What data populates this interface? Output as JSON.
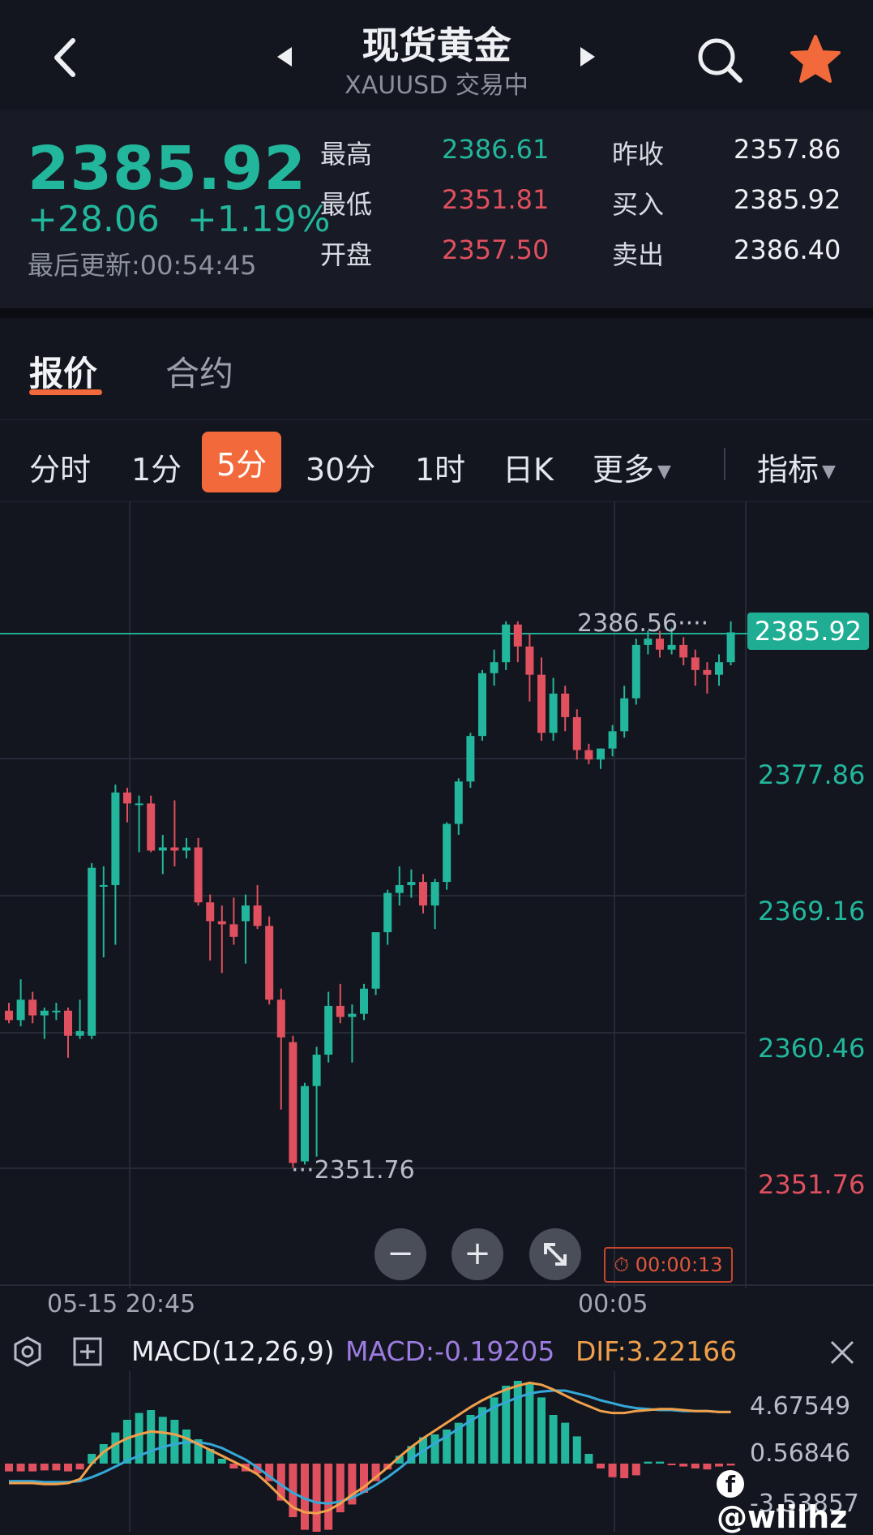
{
  "header": {
    "title": "现货黄金",
    "subtitle": "XAUUSD 交易中"
  },
  "quote": {
    "price": "2385.92",
    "change": "+28.06",
    "change_pct": "+1.19%",
    "last_update": "最后更新:00:54:45",
    "stats": [
      {
        "label": "最高",
        "value": "2386.61",
        "color": "#22b79c"
      },
      {
        "label": "最低",
        "value": "2351.81",
        "color": "#e0505e"
      },
      {
        "label": "开盘",
        "value": "2357.50",
        "color": "#e0505e"
      },
      {
        "label": "昨收",
        "value": "2357.86",
        "color": "#e9ecf2"
      },
      {
        "label": "买入",
        "value": "2385.92",
        "color": "#e9ecf2"
      },
      {
        "label": "卖出",
        "value": "2386.40",
        "color": "#e9ecf2"
      }
    ]
  },
  "tabs": [
    "报价",
    "合约"
  ],
  "periods": [
    "分时",
    "1分",
    "5分",
    "30分",
    "1时",
    "日K",
    "更多",
    "指标"
  ],
  "selected_period": "5分",
  "chart": {
    "current_tag": "2385.92",
    "high_label": "2386.56",
    "low_label": "2351.76",
    "y_labels": [
      {
        "v": "2377.86",
        "color": "#22b79c"
      },
      {
        "v": "2369.16",
        "color": "#22b79c"
      },
      {
        "v": "2360.46",
        "color": "#22b79c"
      },
      {
        "v": "2351.76",
        "color": "#e0505e"
      }
    ],
    "x_labels": [
      "05-15 20:45",
      "00:05"
    ],
    "timer": "00:00:13",
    "controls": {
      "zoom_out": "−",
      "zoom_in": "+"
    }
  },
  "chart_data": {
    "type": "candlestick",
    "candles": [
      [
        2361.8,
        2362.3,
        2361.0,
        2361.2
      ],
      [
        2361.2,
        2363.8,
        2360.8,
        2362.5
      ],
      [
        2362.5,
        2363.0,
        2361.0,
        2361.5
      ],
      [
        2361.5,
        2362.0,
        2360.0,
        2361.8
      ],
      [
        2361.8,
        2362.3,
        2361.2,
        2361.8
      ],
      [
        2361.8,
        2362.0,
        2358.8,
        2360.2
      ],
      [
        2360.2,
        2362.5,
        2360.0,
        2360.5
      ],
      [
        2360.2,
        2371.2,
        2360.0,
        2370.9
      ],
      [
        2369.8,
        2371.0,
        2365.2,
        2369.8
      ],
      [
        2369.8,
        2376.2,
        2366.0,
        2375.7
      ],
      [
        2375.7,
        2376.0,
        2373.8,
        2375.0
      ],
      [
        2375.0,
        2375.5,
        2371.9,
        2375.0
      ],
      [
        2375.0,
        2375.5,
        2371.9,
        2372.0
      ],
      [
        2372.0,
        2373.0,
        2370.5,
        2372.2
      ],
      [
        2372.2,
        2375.2,
        2371.0,
        2372.0
      ],
      [
        2372.0,
        2372.8,
        2371.5,
        2372.2
      ],
      [
        2372.2,
        2372.8,
        2368.5,
        2368.7
      ],
      [
        2368.7,
        2369.2,
        2365.0,
        2367.5
      ],
      [
        2367.5,
        2368.5,
        2364.2,
        2367.3
      ],
      [
        2367.3,
        2369.0,
        2366.0,
        2366.5
      ],
      [
        2367.5,
        2369.2,
        2364.8,
        2368.5
      ],
      [
        2368.5,
        2369.8,
        2367.0,
        2367.2
      ],
      [
        2367.2,
        2367.8,
        2362.2,
        2362.5
      ],
      [
        2362.5,
        2363.2,
        2355.5,
        2360.1
      ],
      [
        2359.8,
        2360.2,
        2351.8,
        2352.1
      ],
      [
        2352.2,
        2357.2,
        2352.0,
        2357.0
      ],
      [
        2357.0,
        2359.5,
        2352.5,
        2359.0
      ],
      [
        2359.0,
        2363.0,
        2358.5,
        2362.1
      ],
      [
        2362.1,
        2363.5,
        2361.0,
        2361.4
      ],
      [
        2361.4,
        2362.2,
        2358.5,
        2361.6
      ],
      [
        2361.6,
        2363.5,
        2361.2,
        2363.2
      ],
      [
        2363.2,
        2366.5,
        2362.8,
        2366.8
      ],
      [
        2366.8,
        2369.5,
        2366.0,
        2369.3
      ],
      [
        2369.3,
        2371.0,
        2368.5,
        2369.8
      ],
      [
        2369.8,
        2370.8,
        2369.0,
        2370.0
      ],
      [
        2370.0,
        2370.5,
        2368.0,
        2368.5
      ],
      [
        2368.5,
        2370.2,
        2367.0,
        2370.0
      ],
      [
        2370.0,
        2373.8,
        2369.5,
        2373.7
      ],
      [
        2373.7,
        2376.6,
        2373.0,
        2376.4
      ],
      [
        2376.4,
        2379.5,
        2376.0,
        2379.3
      ],
      [
        2379.3,
        2383.5,
        2379.0,
        2383.3
      ],
      [
        2383.3,
        2384.8,
        2382.5,
        2384.0
      ],
      [
        2384.0,
        2386.6,
        2383.5,
        2386.4
      ],
      [
        2386.4,
        2386.6,
        2384.0,
        2385.0
      ],
      [
        2385.0,
        2385.8,
        2381.5,
        2383.2
      ],
      [
        2383.2,
        2384.3,
        2379.0,
        2379.5
      ],
      [
        2379.5,
        2383.0,
        2379.0,
        2382.0
      ],
      [
        2382.0,
        2382.5,
        2379.6,
        2380.5
      ],
      [
        2380.5,
        2381.0,
        2377.8,
        2378.4
      ],
      [
        2378.4,
        2378.8,
        2377.5,
        2377.8
      ],
      [
        2377.8,
        2378.5,
        2377.2,
        2378.5
      ],
      [
        2378.5,
        2380.0,
        2378.0,
        2379.6
      ],
      [
        2379.6,
        2382.5,
        2379.2,
        2381.7
      ],
      [
        2381.7,
        2385.5,
        2381.3,
        2385.1
      ],
      [
        2385.1,
        2386.0,
        2384.5,
        2385.5
      ],
      [
        2385.5,
        2386.0,
        2384.3,
        2384.8
      ],
      [
        2384.8,
        2386.2,
        2384.5,
        2385.1
      ],
      [
        2385.1,
        2385.6,
        2383.8,
        2384.3
      ],
      [
        2384.3,
        2384.8,
        2382.5,
        2383.5
      ],
      [
        2383.5,
        2384.0,
        2382.0,
        2383.2
      ],
      [
        2383.2,
        2384.5,
        2382.5,
        2384.0
      ],
      [
        2384.0,
        2386.6,
        2383.8,
        2385.9
      ]
    ],
    "macd": {
      "title": "MACD(12,26,9)",
      "macd_label": "MACD:-0.19205",
      "dif_label": "DIF:3.22166",
      "y_labels": [
        "4.67549",
        "0.56846",
        "-3.53857"
      ],
      "hist": [
        -0.8,
        -0.8,
        -0.8,
        -0.7,
        -0.7,
        -0.8,
        -0.6,
        1.0,
        2.0,
        3.2,
        4.5,
        5.2,
        5.5,
        4.8,
        4.5,
        3.5,
        2.5,
        1.5,
        0.5,
        -0.5,
        -0.8,
        -1.0,
        -1.8,
        -3.8,
        -5.5,
        -6.8,
        -7.5,
        -6.8,
        -5.0,
        -4.2,
        -3.0,
        -1.8,
        -0.6,
        0.8,
        1.8,
        2.7,
        3.0,
        3.5,
        4.2,
        5.0,
        5.8,
        6.8,
        8.0,
        8.5,
        8.2,
        6.8,
        5.0,
        4.2,
        2.8,
        1.0,
        -0.5,
        -1.4,
        -1.5,
        -1.2,
        0.2,
        0.2,
        -0.1,
        -0.3,
        -0.5,
        -0.6,
        -0.3,
        -0.2
      ],
      "dif": [
        -2.0,
        -2.0,
        -2.0,
        -2.1,
        -2.1,
        -2.0,
        -1.6,
        0.0,
        1.2,
        2.0,
        2.6,
        3.0,
        3.3,
        3.2,
        3.0,
        2.6,
        2.0,
        1.4,
        0.8,
        0.2,
        -0.4,
        -1.1,
        -2.2,
        -3.4,
        -4.5,
        -5.0,
        -5.1,
        -4.8,
        -4.1,
        -3.2,
        -2.4,
        -1.4,
        -0.4,
        0.7,
        1.7,
        2.6,
        3.4,
        4.2,
        5.0,
        5.8,
        6.5,
        7.1,
        7.6,
        8.0,
        8.3,
        8.1,
        7.6,
        7.0,
        6.4,
        5.9,
        5.4,
        5.2,
        5.2,
        5.4,
        5.5,
        5.6,
        5.6,
        5.5,
        5.4,
        5.4,
        5.3,
        5.3
      ],
      "dea": [
        -1.8,
        -1.8,
        -1.8,
        -1.9,
        -1.9,
        -1.9,
        -1.8,
        -1.4,
        -0.9,
        -0.3,
        0.3,
        0.8,
        1.3,
        1.7,
        2.0,
        2.2,
        2.2,
        2.0,
        1.6,
        1.0,
        0.4,
        -0.4,
        -1.3,
        -2.2,
        -3.0,
        -3.6,
        -4.0,
        -4.1,
        -3.9,
        -3.5,
        -2.9,
        -2.2,
        -1.4,
        -0.5,
        0.5,
        1.3,
        2.1,
        2.8,
        3.6,
        4.4,
        5.1,
        5.8,
        6.3,
        6.8,
        7.2,
        7.4,
        7.5,
        7.5,
        7.2,
        6.9,
        6.5,
        6.2,
        5.9,
        5.7,
        5.6,
        5.5,
        5.5,
        5.4,
        5.4,
        5.4,
        5.3,
        5.3
      ]
    }
  },
  "watermark": "@wlilhz",
  "colors": {
    "up": "#22b79c",
    "down": "#e0505e",
    "accent": "#f26a3b",
    "dif": "#f0a04b",
    "dea": "#35a8d8",
    "macd": "#9c7ce0"
  }
}
